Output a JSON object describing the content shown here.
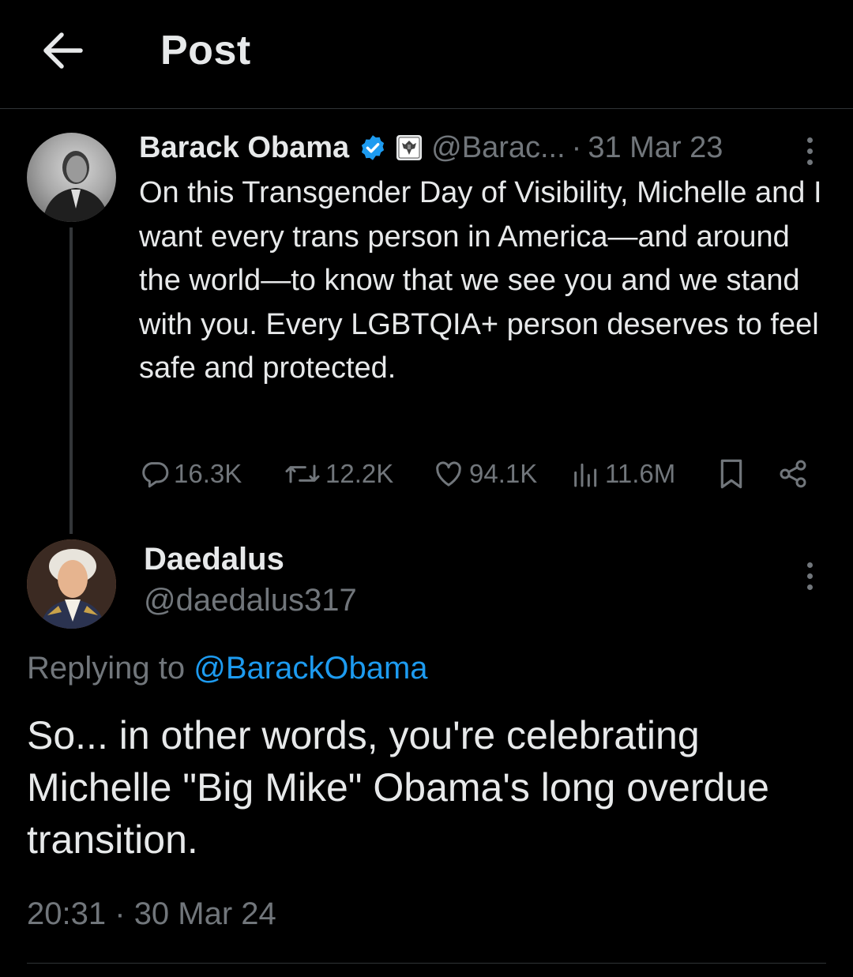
{
  "header": {
    "title": "Post",
    "back_icon": "arrow-left-icon"
  },
  "parent_tweet": {
    "display_name": "Barack Obama",
    "verified_icon": "verified-badge-icon",
    "affiliation_icon": "government-seal-icon",
    "handle": "@Barac...",
    "separator": "·",
    "date": "31 Mar 23",
    "text": "On this Transgender Day of Visibility, Michelle and I want every trans person in America—and around the world—to know that we see you and we stand with you. Every LGBTQIA+ person deserves to feel safe and protected.",
    "stats": {
      "replies": "16.3K",
      "reposts": "12.2K",
      "likes": "94.1K",
      "views": "11.6M"
    }
  },
  "reply": {
    "display_name": "Daedalus",
    "handle": "@daedalus317",
    "replying_to_label": "Replying to",
    "replying_to_handle": "@BarackObama",
    "text": "So... in other words, you're celebrating Michelle \"Big Mike\" Obama's long overdue transition.",
    "time": "20:31",
    "separator": "·",
    "date": "30 Mar 24"
  },
  "colors": {
    "background": "#000000",
    "text": "#e7e9ea",
    "muted": "#71767b",
    "accent": "#1d9bf0"
  }
}
